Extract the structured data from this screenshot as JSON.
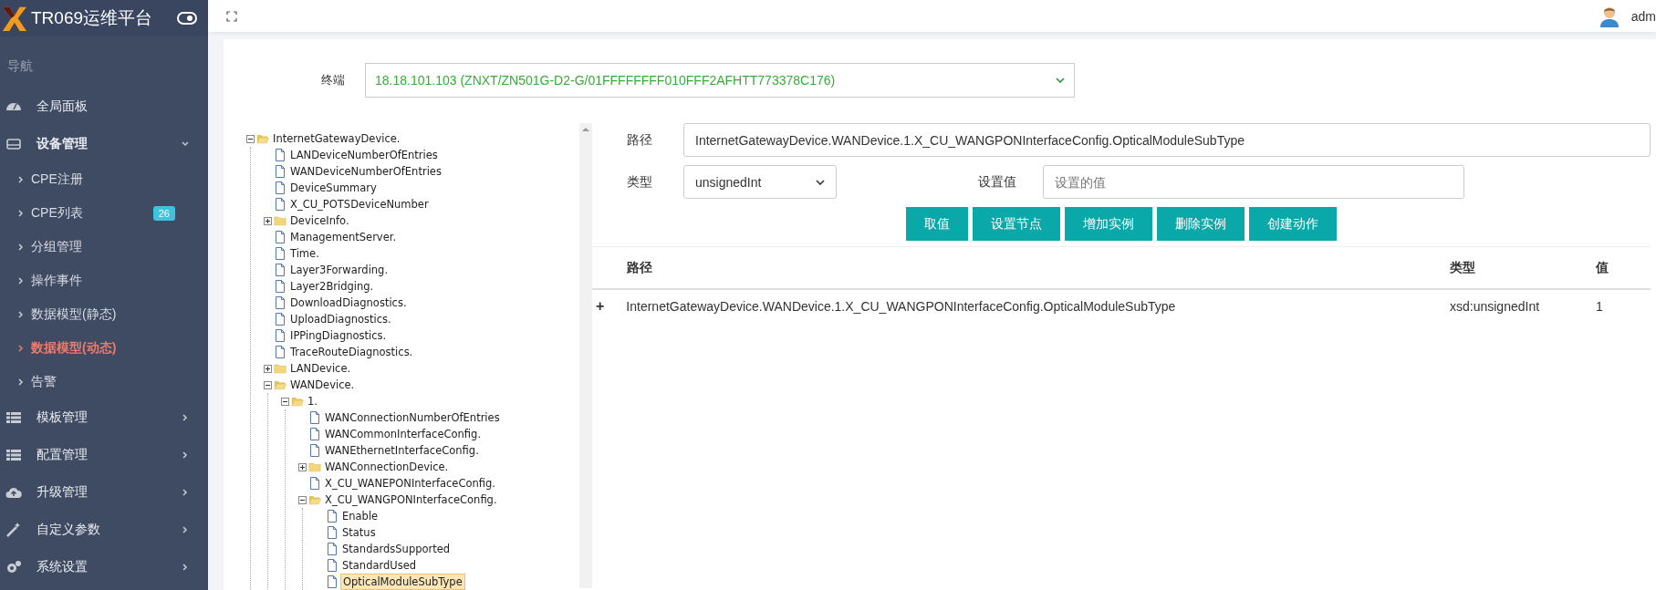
{
  "header": {
    "title": "TR069运维平台",
    "user": "adm"
  },
  "sidebar": {
    "heading": "导航",
    "items": [
      {
        "label": "全局面板"
      },
      {
        "label": "设备管理",
        "expanded": true,
        "children": [
          {
            "label": "CPE注册",
            "selected": false
          },
          {
            "label": "CPE列表",
            "selected": false,
            "badge": "26"
          },
          {
            "label": "分组管理",
            "selected": false
          },
          {
            "label": "操作事件",
            "selected": false
          },
          {
            "label": "数据模型(静态)",
            "selected": false
          },
          {
            "label": "数据模型(动态)",
            "selected": true
          },
          {
            "label": "告警",
            "selected": false
          }
        ]
      },
      {
        "label": "模板管理",
        "expanded": false
      },
      {
        "label": "配置管理",
        "expanded": false
      },
      {
        "label": "升级管理",
        "expanded": false
      },
      {
        "label": "自定义参数",
        "expanded": false
      },
      {
        "label": "系统设置",
        "expanded": false
      }
    ]
  },
  "terminal": {
    "label": "终端",
    "value": "18.18.101.103 (ZNXT/ZN501G-D2-G/01FFFFFFFF010FFF2AFHTT773378C176)"
  },
  "tree": [
    {
      "label": "InternetGatewayDevice.",
      "kind": "folder",
      "expanded": true,
      "selected": false,
      "children": [
        {
          "label": "LANDeviceNumberOfEntries",
          "kind": "file",
          "selected": false
        },
        {
          "label": "WANDeviceNumberOfEntries",
          "kind": "file",
          "selected": false
        },
        {
          "label": "DeviceSummary",
          "kind": "file",
          "selected": false
        },
        {
          "label": "X_CU_POTSDeviceNumber",
          "kind": "file",
          "selected": false
        },
        {
          "label": "DeviceInfo.",
          "kind": "folder",
          "expanded": false,
          "selected": false
        },
        {
          "label": "ManagementServer.",
          "kind": "file",
          "selected": false
        },
        {
          "label": "Time.",
          "kind": "file",
          "selected": false
        },
        {
          "label": "Layer3Forwarding.",
          "kind": "file",
          "selected": false
        },
        {
          "label": "Layer2Bridging.",
          "kind": "file",
          "selected": false
        },
        {
          "label": "DownloadDiagnostics.",
          "kind": "file",
          "selected": false
        },
        {
          "label": "UploadDiagnostics.",
          "kind": "file",
          "selected": false
        },
        {
          "label": "IPPingDiagnostics.",
          "kind": "file",
          "selected": false
        },
        {
          "label": "TraceRouteDiagnostics.",
          "kind": "file",
          "selected": false
        },
        {
          "label": "LANDevice.",
          "kind": "folder",
          "expanded": false,
          "selected": false
        },
        {
          "label": "WANDevice.",
          "kind": "folder",
          "expanded": true,
          "selected": false,
          "children": [
            {
              "label": "1.",
              "kind": "folder",
              "expanded": true,
              "selected": false,
              "children": [
                {
                  "label": "WANConnectionNumberOfEntries",
                  "kind": "file",
                  "selected": false
                },
                {
                  "label": "WANCommonInterfaceConfig.",
                  "kind": "file",
                  "selected": false
                },
                {
                  "label": "WANEthernetInterfaceConfig.",
                  "kind": "file",
                  "selected": false
                },
                {
                  "label": "WANConnectionDevice.",
                  "kind": "folder",
                  "expanded": false,
                  "selected": false
                },
                {
                  "label": "X_CU_WANEPONInterfaceConfig.",
                  "kind": "file",
                  "selected": false
                },
                {
                  "label": "X_CU_WANGPONInterfaceConfig.",
                  "kind": "folder",
                  "expanded": true,
                  "selected": false,
                  "children": [
                    {
                      "label": "Enable",
                      "kind": "file",
                      "selected": false
                    },
                    {
                      "label": "Status",
                      "kind": "file",
                      "selected": false
                    },
                    {
                      "label": "StandardsSupported",
                      "kind": "file",
                      "selected": false
                    },
                    {
                      "label": "StandardUsed",
                      "kind": "file",
                      "selected": false
                    },
                    {
                      "label": "OpticalModuleSubType",
                      "kind": "file",
                      "selected": true
                    }
                  ]
                }
              ]
            }
          ]
        }
      ]
    }
  ],
  "form": {
    "path_label": "路径",
    "path_value": "InternetGatewayDevice.WANDevice.1.X_CU_WANGPONInterfaceConfig.OpticalModuleSubType",
    "type_label": "类型",
    "type_value": "unsignedInt",
    "set_label": "设置值",
    "set_placeholder": "设置的值"
  },
  "buttons": [
    "取值",
    "设置节点",
    "增加实例",
    "删除实例",
    "创建动作"
  ],
  "table": {
    "columns": [
      "路径",
      "类型",
      "值"
    ],
    "rows": [
      {
        "expander": "+",
        "cells": [
          "InternetGatewayDevice.WANDevice.1.X_CU_WANGPONInterfaceConfig.OpticalModuleSubType",
          "xsd:unsignedInt",
          "1"
        ]
      }
    ]
  }
}
